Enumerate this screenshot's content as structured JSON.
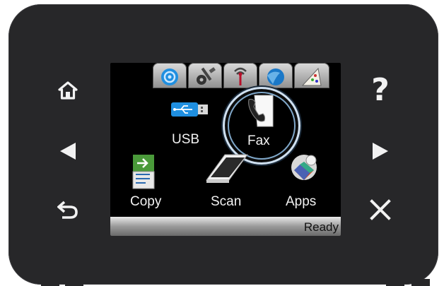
{
  "left_buttons": [
    {
      "icon": "home-icon"
    },
    {
      "icon": "left-arrow-icon"
    },
    {
      "icon": "back-icon"
    }
  ],
  "right_buttons": [
    {
      "icon": "help-icon",
      "glyph": "?"
    },
    {
      "icon": "right-arrow-icon"
    },
    {
      "icon": "cancel-icon"
    }
  ],
  "screen": {
    "tabs": [
      "web-services-icon",
      "setup-icon",
      "wireless-icon",
      "info-icon",
      "supplies-icon"
    ],
    "apps": {
      "usb": {
        "label": "USB",
        "icon": "usb-icon"
      },
      "fax": {
        "label": "Fax",
        "icon": "fax-icon",
        "selected": true
      },
      "copy": {
        "label": "Copy",
        "icon": "copy-icon"
      },
      "scan": {
        "label": "Scan",
        "icon": "scan-icon"
      },
      "apps": {
        "label": "Apps",
        "icon": "apps-icon"
      }
    },
    "status": "Ready"
  },
  "colors": {
    "panel": "#272729",
    "screen": "#000000",
    "focus_ring": "#cfe0f0",
    "usb_blue": "#1f8fe0"
  }
}
